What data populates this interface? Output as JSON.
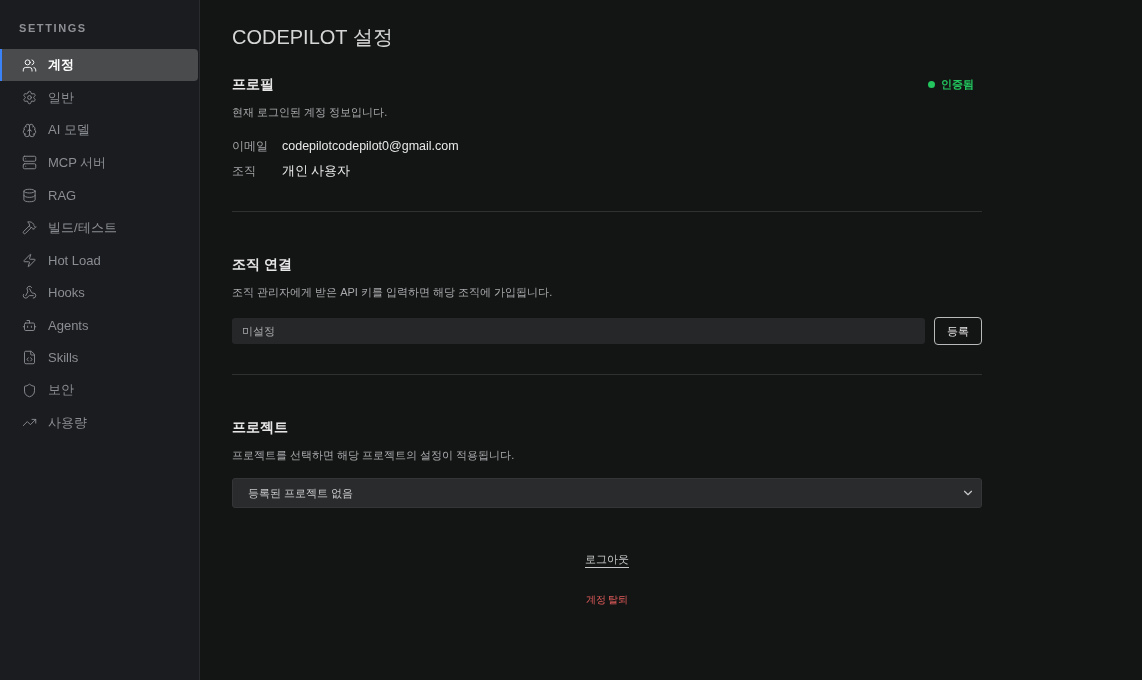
{
  "sidebar": {
    "heading": "SETTINGS",
    "items": [
      {
        "label": "계정",
        "selected": true
      },
      {
        "label": "일반",
        "selected": false
      },
      {
        "label": "AI 모델",
        "selected": false
      },
      {
        "label": "MCP 서버",
        "selected": false
      },
      {
        "label": "RAG",
        "selected": false
      },
      {
        "label": "빌드/테스트",
        "selected": false
      },
      {
        "label": "Hot Load",
        "selected": false
      },
      {
        "label": "Hooks",
        "selected": false
      },
      {
        "label": "Agents",
        "selected": false
      },
      {
        "label": "Skills",
        "selected": false
      },
      {
        "label": "보안",
        "selected": false
      },
      {
        "label": "사용량",
        "selected": false
      }
    ]
  },
  "page": {
    "title": "CODEPILOT 설정"
  },
  "profile": {
    "heading": "프로필",
    "badge": "인증됨",
    "description": "현재 로그인된 계정 정보입니다.",
    "fields": [
      {
        "label": "이메일",
        "value": "codepilotcodepilot0@gmail.com"
      },
      {
        "label": "조직",
        "value": "개인 사용자"
      }
    ]
  },
  "organization": {
    "heading": "조직 연결",
    "description": "조직 관리자에게 받은 API 키를 입력하면 해당 조직에 가입됩니다.",
    "api_key_input": {
      "placeholder": "미설정"
    },
    "register_button": "등록"
  },
  "project": {
    "heading": "프로젝트",
    "description": "프로젝트를 선택하면 해당 프로젝트의 설정이 적용됩니다.",
    "select": {
      "value": "등록된 프로젝트 없음"
    }
  },
  "actions": {
    "logout": "로그아웃",
    "delete_account": "계정 탈퇴"
  }
}
